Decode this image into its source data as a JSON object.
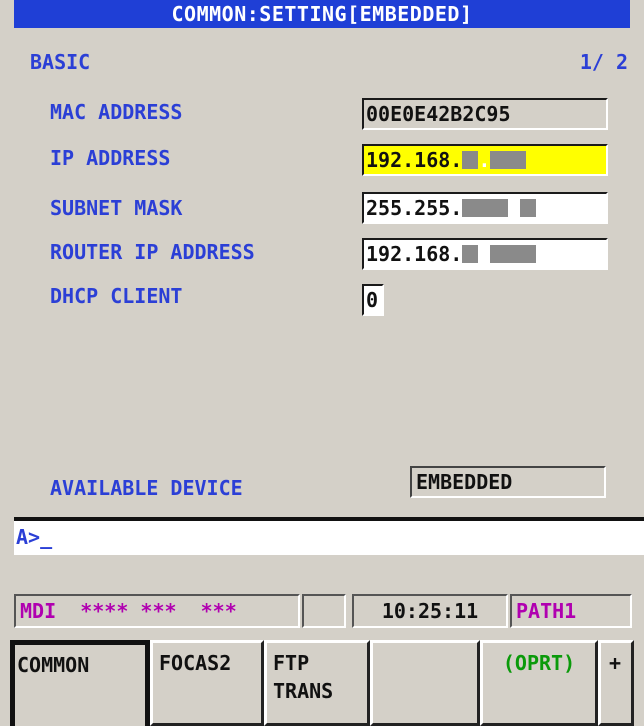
{
  "title": "COMMON:SETTING[EMBEDDED]",
  "section": "BASIC",
  "page": "1/ 2",
  "settings": [
    {
      "label": "MAC ADDRESS",
      "value": "00E0E42B2C95"
    },
    {
      "label": "IP ADDRESS",
      "value": "192.168."
    },
    {
      "label": "SUBNET MASK",
      "value": "255.255."
    },
    {
      "label": "ROUTER IP ADDRESS",
      "value": "192.168."
    },
    {
      "label": "DHCP CLIENT",
      "value": "0"
    }
  ],
  "available_device": {
    "label": "AVAILABLE DEVICE",
    "value": "EMBEDDED"
  },
  "input_prompt": "A>_",
  "status": {
    "mode": "MDI  **** ***  ***",
    "time": "10:25:11",
    "path": "PATH1"
  },
  "softkeys": [
    {
      "line1": "COMMON",
      "line2": ""
    },
    {
      "line1": "FOCAS2",
      "line2": ""
    },
    {
      "line1": "FTP",
      "line2": "TRANS"
    },
    {
      "line1": "",
      "line2": ""
    },
    {
      "line1": "(OPRT)",
      "line2": ""
    },
    {
      "line1": "+",
      "line2": ""
    }
  ],
  "colors": {
    "title_bg": "#1f3fd6",
    "label_text": "#2b3fd6",
    "active_field": "#ffff00",
    "status_magenta": "#b000b0",
    "oprt_green": "#0a9a0a"
  }
}
